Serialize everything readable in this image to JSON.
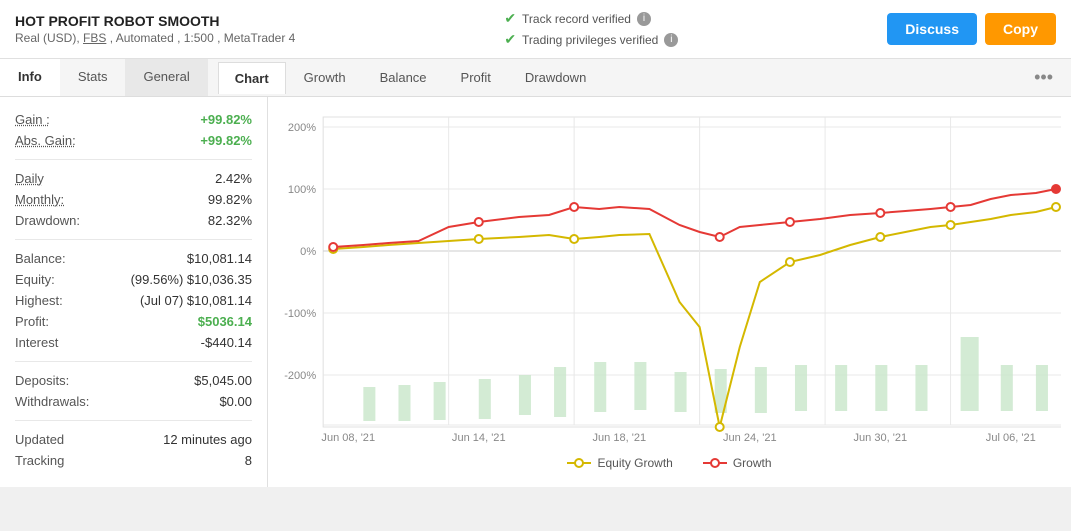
{
  "header": {
    "title": "HOT PROFIT ROBOT SMOOTH",
    "subtitle": "Real (USD), FBS , Automated , 1:500 , MetaTrader 4",
    "badge1": "Track record verified",
    "badge2": "Trading privileges verified",
    "btn_discuss": "Discuss",
    "btn_copy": "Copy"
  },
  "left_tabs": [
    {
      "label": "Info",
      "active": true
    },
    {
      "label": "Stats",
      "active": false
    },
    {
      "label": "General",
      "active": false
    }
  ],
  "chart_tabs": [
    {
      "label": "Chart",
      "active": true
    },
    {
      "label": "Growth",
      "active": false
    },
    {
      "label": "Balance",
      "active": false
    },
    {
      "label": "Profit",
      "active": false
    },
    {
      "label": "Drawdown",
      "active": false
    }
  ],
  "stats": {
    "gain_label": "Gain :",
    "gain_value": "+99.82%",
    "abs_gain_label": "Abs. Gain:",
    "abs_gain_value": "+99.82%",
    "daily_label": "Daily",
    "daily_value": "2.42%",
    "monthly_label": "Monthly:",
    "monthly_value": "99.82%",
    "drawdown_label": "Drawdown:",
    "drawdown_value": "82.32%",
    "balance_label": "Balance:",
    "balance_value": "$10,081.14",
    "equity_label": "Equity:",
    "equity_value": "(99.56%) $10,036.35",
    "highest_label": "Highest:",
    "highest_value": "(Jul 07) $10,081.14",
    "profit_label": "Profit:",
    "profit_value": "$5036.14",
    "interest_label": "Interest",
    "interest_value": "-$440.14",
    "deposits_label": "Deposits:",
    "deposits_value": "$5,045.00",
    "withdrawals_label": "Withdrawals:",
    "withdrawals_value": "$0.00",
    "updated_label": "Updated",
    "updated_value": "12 minutes ago",
    "tracking_label": "Tracking",
    "tracking_value": "8"
  },
  "legend": {
    "equity_label": "Equity Growth",
    "equity_color": "#d4b800",
    "growth_label": "Growth",
    "growth_color": "#e53935"
  },
  "chart": {
    "x_labels": [
      "Jun 08, '21",
      "Jun 14, '21",
      "Jun 18, '21",
      "Jun 24, '21",
      "Jun 30, '21",
      "Jul 06, '21"
    ],
    "y_labels": [
      "200%",
      "100%",
      "0%",
      "-100%",
      "-200%"
    ]
  }
}
